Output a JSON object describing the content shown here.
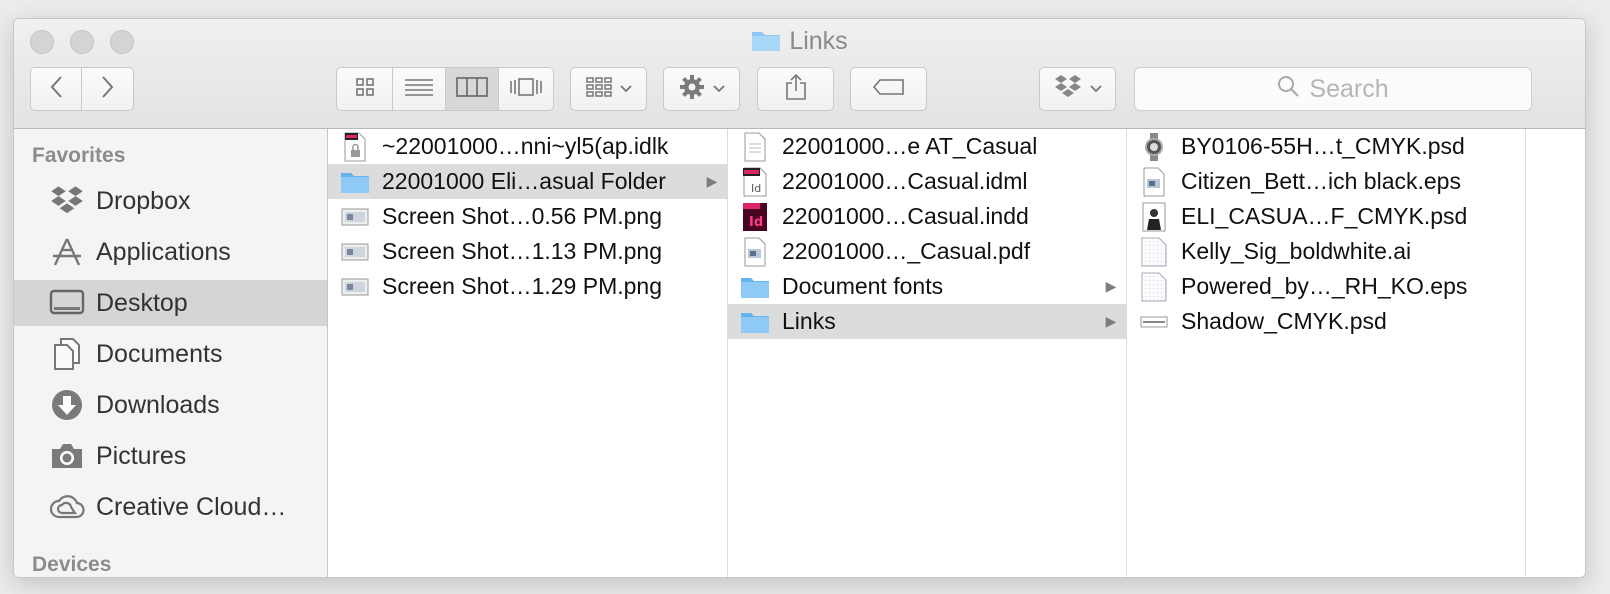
{
  "window": {
    "title": "Links"
  },
  "toolbar": {
    "back_icon": "chevron-left-icon",
    "forward_icon": "chevron-right-icon",
    "search_placeholder": "Search"
  },
  "sidebar": {
    "favorites_heading": "Favorites",
    "devices_heading": "Devices",
    "items": [
      {
        "label": "Dropbox",
        "icon": "dropbox-icon"
      },
      {
        "label": "Applications",
        "icon": "applications-icon"
      },
      {
        "label": "Desktop",
        "icon": "desktop-icon",
        "selected": true
      },
      {
        "label": "Documents",
        "icon": "documents-icon"
      },
      {
        "label": "Downloads",
        "icon": "downloads-icon"
      },
      {
        "label": "Pictures",
        "icon": "camera-icon"
      },
      {
        "label": "Creative Cloud…",
        "icon": "creative-cloud-icon"
      }
    ]
  },
  "columns": [
    {
      "items": [
        {
          "label": "~22001000…nni~yl5(ap.idlk",
          "icon": "lock-file-icon"
        },
        {
          "label": "22001000 Eli…asual Folder",
          "icon": "folder-icon",
          "selected": true,
          "has_children": true
        },
        {
          "label": "Screen Shot…0.56 PM.png",
          "icon": "image-file-icon"
        },
        {
          "label": "Screen Shot…1.13 PM.png",
          "icon": "image-file-icon"
        },
        {
          "label": "Screen Shot…1.29 PM.png",
          "icon": "image-file-icon"
        }
      ]
    },
    {
      "items": [
        {
          "label": "22001000…e AT_Casual",
          "icon": "document-file-icon"
        },
        {
          "label": "22001000…Casual.idml",
          "icon": "idml-file-icon"
        },
        {
          "label": "22001000…Casual.indd",
          "icon": "indd-file-icon"
        },
        {
          "label": "22001000…_Casual.pdf",
          "icon": "pdf-file-icon"
        },
        {
          "label": "Document fonts",
          "icon": "folder-icon",
          "has_children": true
        },
        {
          "label": "Links",
          "icon": "folder-icon",
          "selected": true,
          "has_children": true
        }
      ]
    },
    {
      "items": [
        {
          "label": "BY0106-55H…t_CMYK.psd",
          "icon": "watch-thumbnail-icon"
        },
        {
          "label": "Citizen_Bett…ich black.eps",
          "icon": "eps-file-icon"
        },
        {
          "label": "ELI_CASUA…F_CMYK.psd",
          "icon": "portrait-thumbnail-icon"
        },
        {
          "label": "Kelly_Sig_boldwhite.ai",
          "icon": "blank-file-icon"
        },
        {
          "label": "Powered_by…_RH_KO.eps",
          "icon": "blank-file-icon"
        },
        {
          "label": "Shadow_CMYK.psd",
          "icon": "shadow-thumbnail-icon"
        }
      ]
    }
  ]
}
